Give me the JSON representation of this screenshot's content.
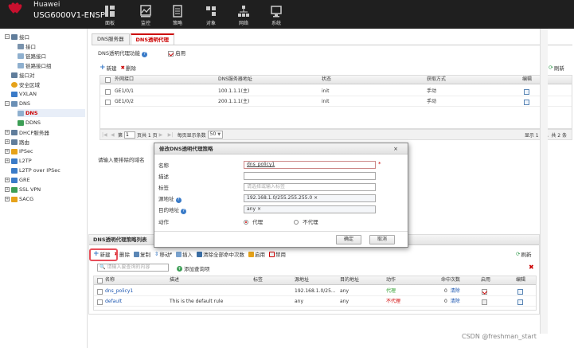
{
  "header": {
    "brand": "Huawei",
    "product": "USG6000V1-ENSP",
    "nav": [
      {
        "label": "面板",
        "icon": "dashboard-icon"
      },
      {
        "label": "监控",
        "icon": "monitor-icon"
      },
      {
        "label": "策略",
        "icon": "policy-icon"
      },
      {
        "label": "对象",
        "icon": "object-icon"
      },
      {
        "label": "网络",
        "icon": "network-icon"
      },
      {
        "label": "系统",
        "icon": "system-icon"
      }
    ],
    "colors": {
      "bar": "#1f1f1f",
      "logo": "#c8102e"
    }
  },
  "sidebar": {
    "items": [
      {
        "label": "接口",
        "icon": "interface-icon"
      },
      {
        "label": "接口",
        "icon": "interface-icon"
      },
      {
        "label": "链路接口",
        "icon": "link-interface-icon"
      },
      {
        "label": "链路接口组",
        "icon": "link-group-icon"
      },
      {
        "label": "接口对",
        "icon": "interface-pair-icon"
      },
      {
        "label": "安全区域",
        "icon": "security-zone-icon"
      },
      {
        "label": "VXLAN",
        "icon": "vxlan-icon"
      },
      {
        "label": "DNS",
        "icon": "dns-icon"
      },
      {
        "label": "DNS",
        "icon": "dns-icon"
      },
      {
        "label": "DDNS",
        "icon": "ddns-icon"
      },
      {
        "label": "DHCP服务器",
        "icon": "dhcp-icon"
      },
      {
        "label": "路由",
        "icon": "route-icon"
      },
      {
        "label": "IPSec",
        "icon": "ipsec-icon"
      },
      {
        "label": "L2TP",
        "icon": "l2tp-icon"
      },
      {
        "label": "L2TP over IPSec",
        "icon": "l2tp-ipsec-icon"
      },
      {
        "label": "GRE",
        "icon": "gre-icon"
      },
      {
        "label": "SSL VPN",
        "icon": "sslvpn-icon"
      },
      {
        "label": "SACG",
        "icon": "sacg-icon"
      }
    ]
  },
  "tabs": [
    {
      "label": "DNS服务器"
    },
    {
      "label": "DNS透明代理"
    }
  ],
  "proxy": {
    "enable_label": "DNS透明代理功能",
    "enable_checkbox_label": "启用",
    "enabled": true
  },
  "toolbar1": {
    "new": "新建",
    "delete": "删除"
  },
  "refresh_label": "刷新",
  "iface_table": {
    "columns": [
      "外网接口",
      "DNS服务器地址",
      "状态",
      "获取方式",
      "编辑"
    ],
    "rows": [
      {
        "iface": "GE1/0/1",
        "dns": "100.1.1.1(主)",
        "status": "init",
        "mode": "手动"
      },
      {
        "iface": "GE1/0/2",
        "dns": "200.1.1.1(主)",
        "status": "init",
        "mode": "手动"
      }
    ]
  },
  "pager": {
    "prefix": "第",
    "page": "1",
    "of": "页共 1 页",
    "per_page_label": "每页显示条数",
    "per_page": "50",
    "summary": "显示 1 - 2，共 2 条"
  },
  "exclude_domain_label": "请输入要排除的域名",
  "dialog": {
    "title": "修改DNS透明代理策略",
    "close": "×",
    "fields": {
      "name_label": "名称",
      "name_value": "dns_policy1",
      "desc_label": "描述",
      "tag_label": "标签",
      "tag_placeholder": "请选择或输入标签",
      "src_label": "源地址",
      "src_value": "192.168.1.0/255.255.255.0",
      "dst_label": "目的地址",
      "dst_value": "any",
      "action_label": "动作",
      "action_proxy": "代理",
      "action_noproxy": "不代理",
      "chip_close": "×",
      "required": "*"
    },
    "ok": "确定",
    "cancel": "取消"
  },
  "policy_list": {
    "title": "DNS透明代理策略列表",
    "toolbar": {
      "new": "新建",
      "delete": "删除",
      "copy": "复制",
      "move": "移动",
      "insert": "插入",
      "clear_hits": "清除全部命中次数",
      "enable": "启用",
      "disable": "禁用"
    },
    "search_placeholder": "请输入要查询的内容",
    "add_filter": "添加查询项",
    "columns": [
      "名称",
      "描述",
      "标签",
      "源地址",
      "目的地址",
      "动作",
      "命中次数",
      "启用",
      "编辑"
    ],
    "rows": [
      {
        "name": "dns_policy1",
        "desc": "",
        "tag": "",
        "src": "192.168.1.0/25...",
        "dst": "any",
        "action": "代理",
        "action_color": "#2e9e2e",
        "hits": "0",
        "clear": "清除",
        "enabled": true
      },
      {
        "name": "default",
        "desc": "This is the default rule",
        "tag": "",
        "src": "any",
        "dst": "any",
        "action": "不代理",
        "action_color": "#d00000",
        "hits": "0",
        "clear": "清除",
        "enabled": false
      }
    ]
  },
  "watermark": "CSDN @freshman_start"
}
